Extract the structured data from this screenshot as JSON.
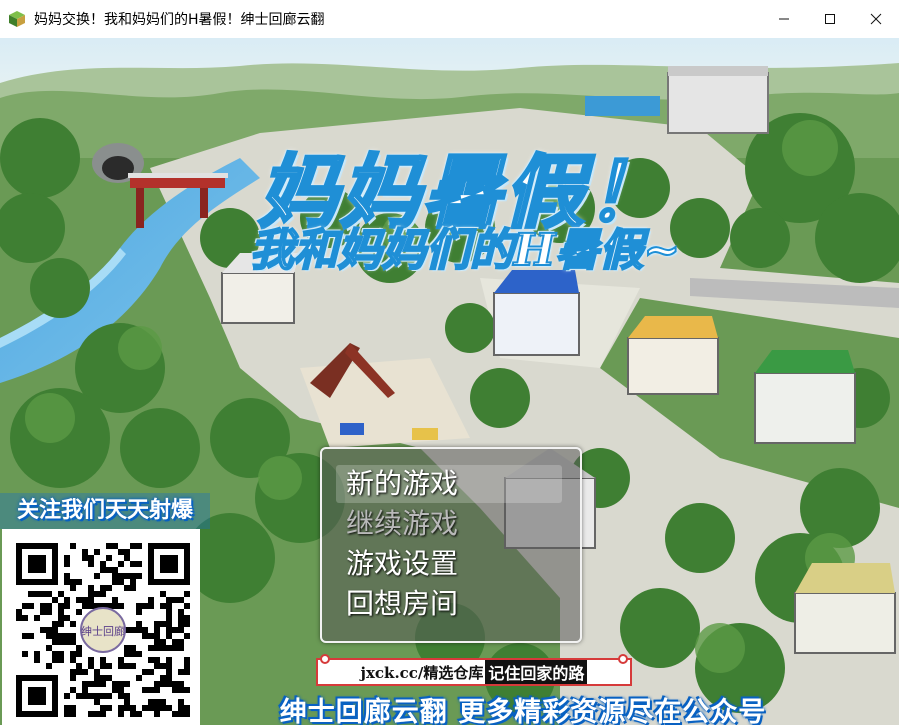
{
  "window": {
    "title": "妈妈交换！我和妈妈们的H暑假！绅士回廊云翻",
    "icons": {
      "app": "game-app-icon",
      "minimize": "minimize-icon",
      "maximize": "maximize-icon",
      "close": "close-icon"
    }
  },
  "logo": {
    "main": "妈妈暑假！",
    "sub": "我和妈妈们的H暑假~"
  },
  "menu": {
    "items": [
      {
        "label": "新的游戏",
        "state": "selected"
      },
      {
        "label": "继续游戏",
        "state": "disabled"
      },
      {
        "label": "游戏设置",
        "state": "normal"
      },
      {
        "label": "回想房间",
        "state": "normal"
      }
    ]
  },
  "promo": {
    "title": "关注我们天天射爆",
    "qr_center_label": "绅士回廊"
  },
  "banner": {
    "url": "jxck.cc/精选仓库",
    "slogan": "记住回家的路"
  },
  "footer": {
    "text": "绅士回廊云翻 更多精彩资源尽在公众号"
  },
  "colors": {
    "logo_outline": "#1f8fd6",
    "promo_blue": "#0a62c2",
    "banner_border": "#d63a3a"
  }
}
